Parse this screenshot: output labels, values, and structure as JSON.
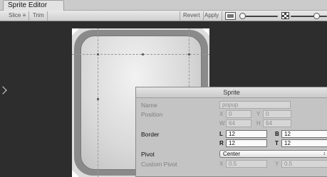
{
  "window": {
    "title": "Sprite Editor"
  },
  "toolbar": {
    "slice_label": "Slice ≡",
    "trim_label": "Trim",
    "revert_label": "Revert",
    "apply_label": "Apply",
    "rgb_icon": "rgb-channel-icon",
    "alpha_icon": "alpha-checker-icon",
    "zoom_slider_value": 0.05,
    "mip_slider_value": 0.6
  },
  "panel": {
    "title": "Sprite",
    "name_label": "Name",
    "name_value": "popup",
    "position_label": "Position",
    "position": {
      "x_axis": "X",
      "x": "0",
      "y_axis": "Y",
      "y": "0",
      "w_axis": "W",
      "w": "64",
      "h_axis": "H",
      "h": "64"
    },
    "border_label": "Border",
    "border": {
      "l_axis": "L",
      "l": "12",
      "b_axis": "B",
      "b": "12",
      "r_axis": "R",
      "r": "12",
      "t_axis": "T",
      "t": "12"
    },
    "pivot_label": "Pivot",
    "pivot_value": "Center",
    "custom_pivot_label": "Custom Pivot",
    "custom_pivot": {
      "x_axis": "X",
      "x": "0.5",
      "y_axis": "Y",
      "y": "0.5"
    }
  },
  "colors": {
    "canvas": "#2d2d2d",
    "panel": "#c4c4c4",
    "accent_field": "#fafafa"
  }
}
